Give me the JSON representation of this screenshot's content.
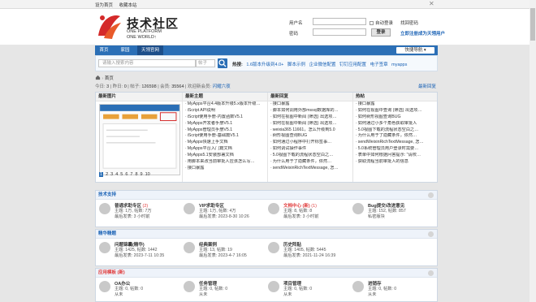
{
  "topbar": {
    "set_home": "设为首页",
    "bookmark": "收藏本站",
    "close": "✕"
  },
  "logo": {
    "title": "技术社区",
    "line1": "ONE PLATFORM",
    "line2": "ONE WORLD↑"
  },
  "login": {
    "username_label": "用户名",
    "password_label": "密码",
    "auto_login": "自动登录",
    "forgot": "找回密码",
    "login_btn": "登录",
    "register": "立即注册成为天翎用户"
  },
  "nav": {
    "items": [
      "首页",
      "家园",
      "天翎官网"
    ],
    "quick": "快捷导航 ▾"
  },
  "search": {
    "placeholder": "请输入搜索内容",
    "select": "帖子",
    "hot_label": "热搜:",
    "hot": [
      "1.6版本升级到4.0+",
      "脚本示例",
      "企业微信配置",
      "钉钉应用配置",
      "电子签章",
      "myapps"
    ]
  },
  "crumbs": "首页",
  "stats": {
    "today_label": "今日:",
    "today": "3",
    "yesterday_label": "昨日:",
    "yesterday": "0",
    "posts_label": "帖子:",
    "posts": "126598",
    "members_label": "会员:",
    "members": "35564",
    "newest_label": "欢迎新会员:",
    "newest": "闪耀六夜",
    "latest": "最新回复"
  },
  "grid": {
    "h1": "最新图片",
    "h2": "最新主题",
    "h3": "最新回复",
    "h4": "热帖",
    "pages": [
      "1",
      "2",
      "3",
      "4",
      "5",
      "6",
      "7",
      "8",
      "9",
      "10"
    ],
    "latest_topics": [
      "MyApps平台4.4版本升级5.x版本升级…",
      "iScript API说明",
      "iScript使用手册-内置函数V5.1",
      "MyApps开发者手册V5.1",
      "MyApps管理员手册V5.1",
      "iScript使用手册-基础篇V5.1",
      "MyApps快速上手文档",
      "MyApps平台入门篇文档",
      "MyApps5.1安装部署文档",
      "用脚本来改当前审批人应该怎么写…",
      "接口暴露"
    ],
    "latest_replies": [
      "接口暴露",
      "脚本如何调用外部mssql数据库的…",
      "如何在视图中新闻 (筛选) 出选项…",
      "如何在视图中新闻 (筛选) 出选项…",
      "weixia365 11661，怎么升级到5.0",
      "树形视图查询BUG",
      "如何通过小程序中打开标签事…",
      "如何调试操作事件",
      "5.0视图下载的流程状态空白之…",
      "为什么用于了隐藏条件，依然…",
      "sendWeixinRichTextMessage, 怎…"
    ],
    "hot_topics": [
      "接口暴露",
      "如何在视图中查询 (筛选) 出选项…",
      "如何树形视图查询BUG",
      "如何通过小多个角色获取审批人",
      "5.0视图下载的流程状态空白之…",
      "为什么用于了隐藏条件，依然…",
      "sendWeixinRichTextMessage, 怎…",
      "5.0系统管理员用户登录时需要…",
      "表单中如何根据问答提示: \"请校…",
      "获取流程当前审批人的信息"
    ]
  },
  "sections": [
    {
      "title": "技术支持",
      "forums": [
        {
          "name": "普通求助专区",
          "badge": "(2)",
          "topics": "主题: 1万, 帖数: 7万",
          "last": "最后发表: 3 小时前"
        },
        {
          "name": "VIP求助专区",
          "badge": "",
          "topics": "主题: 1万, 帖数: 4万",
          "last": "最后发表: 2023-8-30 10:26"
        },
        {
          "name": "文档中心 (新)",
          "badge": "(1)",
          "topics": "主题: 8, 帖数: 8",
          "last": "最后发表: 3 小时前"
        },
        {
          "name": "Bug提交/改进意见",
          "badge": "",
          "topics": "主题: 152, 帖数: 857",
          "last": "私密版块"
        }
      ]
    },
    {
      "title": "精华精题",
      "forums": [
        {
          "name": "问题锦囊(精华)",
          "badge": "",
          "topics": "主题: 1425, 帖数: 1442",
          "last": "最后发表: 2023-7-11 10:35"
        },
        {
          "name": "经典案例",
          "badge": "",
          "topics": "主题: 13, 帖数: 19",
          "last": "最后发表: 2023-4-7 16:05"
        },
        {
          "name": "历史阵贴",
          "badge": "",
          "topics": "主题: 1405, 帖数: 5445",
          "last": "最后发表: 2021-11-24 16:39"
        }
      ]
    },
    {
      "title": "应用模板 (新)",
      "forums": [
        {
          "name": "OA办公",
          "badge": "",
          "topics": "主题: 0, 帖数: 0",
          "last": "从未"
        },
        {
          "name": "任务管理",
          "badge": "",
          "topics": "主题: 0, 帖数: 0",
          "last": "从未"
        },
        {
          "name": "项目管理",
          "badge": "",
          "topics": "主题: 0, 帖数: 0",
          "last": "从未"
        },
        {
          "name": "进销存",
          "badge": "",
          "topics": "主题: 0, 帖数: 0",
          "last": "从未"
        }
      ]
    }
  ],
  "colors": {
    "brand_blue": "#2b6fb6",
    "link": "#1a62b5",
    "accent_red": "#e03c3c"
  }
}
